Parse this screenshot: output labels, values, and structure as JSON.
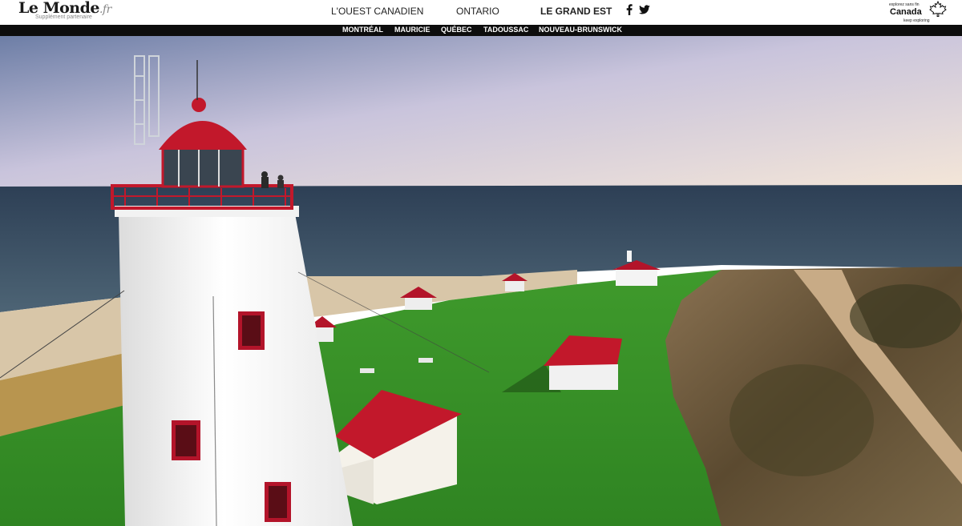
{
  "logo": {
    "name": "Le Monde",
    "suffix": ".fr",
    "subtitle": "Supplément partenaire"
  },
  "nav": {
    "items": [
      {
        "label": "L'OUEST CANADIEN",
        "active": false
      },
      {
        "label": "ONTARIO",
        "active": false
      },
      {
        "label": "LE GRAND EST",
        "active": true
      }
    ]
  },
  "social": {
    "facebook_icon": "facebook-icon",
    "twitter_icon": "twitter-icon"
  },
  "partner": {
    "tagline_fr": "explorez sans fin",
    "name": "Canada",
    "tagline_en": "keep exploring",
    "icon": "maple-leaf-icon"
  },
  "subnav": {
    "items": [
      "MONTRÉAL",
      "MAURICIE",
      "QUÉBEC",
      "TADOUSSAC",
      "NOUVEAU-BRUNSWICK"
    ]
  },
  "colors": {
    "subnav_bg": "#0d0d0d",
    "roof_red": "#c2182b",
    "grass": "#3f9a2c",
    "sea": "#3c5266"
  }
}
